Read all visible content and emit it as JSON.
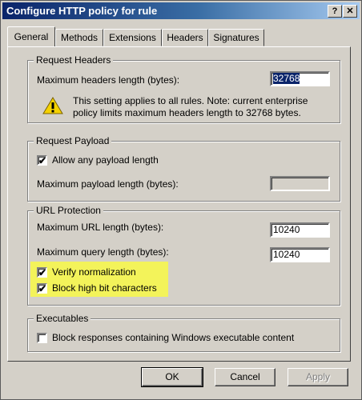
{
  "window": {
    "title": "Configure HTTP policy for rule",
    "help_label": "?",
    "close_label": "✕"
  },
  "tabs": [
    {
      "label": "General"
    },
    {
      "label": "Methods"
    },
    {
      "label": "Extensions"
    },
    {
      "label": "Headers"
    },
    {
      "label": "Signatures"
    }
  ],
  "request_headers": {
    "legend": "Request Headers",
    "max_label": "Maximum headers length (bytes):",
    "max_value": "32768",
    "warning_text": "This setting applies to all rules. Note: current enterprise policy limits maximum headers length to 32768 bytes."
  },
  "request_payload": {
    "legend": "Request Payload",
    "allow_label": "Allow any payload length",
    "allow_checked": "✔",
    "max_label": "Maximum payload length (bytes):",
    "max_value": ""
  },
  "url_protection": {
    "legend": "URL Protection",
    "max_url_label": "Maximum URL length (bytes):",
    "max_url_value": "10240",
    "max_query_label": "Maximum query length (bytes):",
    "max_query_value": "10240",
    "verify_label": "Verify normalization",
    "verify_checked": "✔",
    "block_label": "Block high bit characters",
    "block_checked": "✔",
    "highlight_color": "#f3f35a"
  },
  "executables": {
    "legend": "Executables",
    "block_label": "Block responses containing Windows executable content",
    "block_checked": ""
  },
  "buttons": {
    "ok": "OK",
    "cancel": "Cancel",
    "apply": "Apply"
  }
}
